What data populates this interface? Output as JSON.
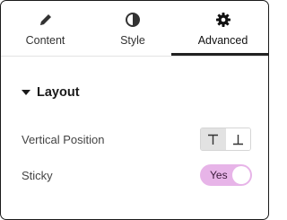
{
  "tabs": [
    {
      "label": "Content",
      "icon": "pencil-icon",
      "active": false
    },
    {
      "label": "Style",
      "icon": "contrast-icon",
      "active": false
    },
    {
      "label": "Advanced",
      "icon": "gear-icon",
      "active": true
    }
  ],
  "section": {
    "title": "Layout",
    "expanded": true
  },
  "vertical_position": {
    "label": "Vertical Position",
    "options": [
      {
        "icon": "align-top-icon",
        "selected": true
      },
      {
        "icon": "align-bottom-icon",
        "selected": false
      }
    ]
  },
  "sticky": {
    "label": "Sticky",
    "value": "Yes",
    "on": true
  },
  "colors": {
    "toggle_on": "#e7b4e8",
    "active_tab_indicator": "#222222",
    "selected_option": "#e2e2e2"
  }
}
